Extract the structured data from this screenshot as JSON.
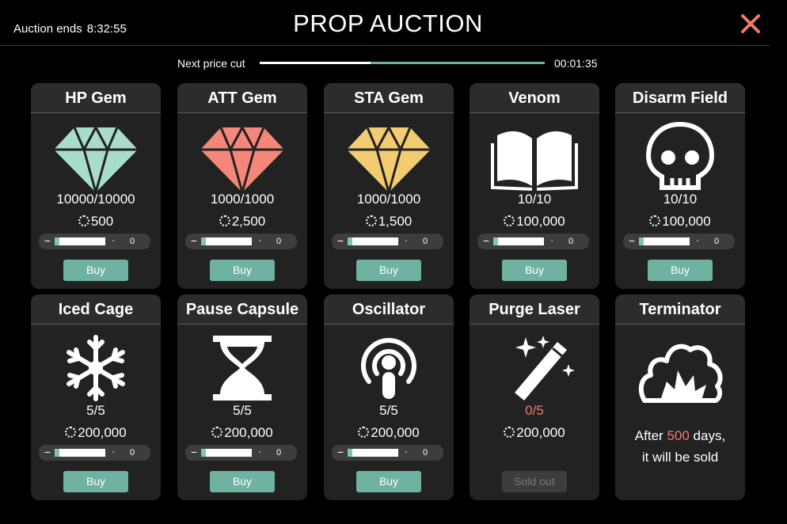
{
  "header": {
    "ends_label": "Auction ends",
    "ends_time": "8:32:55",
    "title": "PROP AUCTION",
    "close_icon": "close-icon",
    "accent": "#f07b6c"
  },
  "price_cut": {
    "label": "Next price cut",
    "time": "00:01:35",
    "progress_percent": 39
  },
  "colors": {
    "button": "#6fb2a2",
    "hp_gem": "#a8dccb",
    "att_gem": "#f5867a",
    "sta_gem": "#f3cb70",
    "sold_out_stock": "#f07b6c"
  },
  "items": [
    {
      "name": "HP Gem",
      "icon": "diamond-icon",
      "stock": "10000/10000",
      "price": "500",
      "qty": "0",
      "buy": "Buy"
    },
    {
      "name": "ATT Gem",
      "icon": "diamond-icon",
      "stock": "1000/1000",
      "price": "2,500",
      "qty": "0",
      "buy": "Buy"
    },
    {
      "name": "STA Gem",
      "icon": "diamond-icon",
      "stock": "1000/1000",
      "price": "1,500",
      "qty": "0",
      "buy": "Buy"
    },
    {
      "name": "Venom",
      "icon": "book-icon",
      "stock": "10/10",
      "price": "100,000",
      "qty": "0",
      "buy": "Buy"
    },
    {
      "name": "Disarm Field",
      "icon": "skull-icon",
      "stock": "10/10",
      "price": "100,000",
      "qty": "0",
      "buy": "Buy"
    },
    {
      "name": "Iced Cage",
      "icon": "snowflake-icon",
      "stock": "5/5",
      "price": "200,000",
      "qty": "0",
      "buy": "Buy"
    },
    {
      "name": "Pause Capsule",
      "icon": "hourglass-icon",
      "stock": "5/5",
      "price": "200,000",
      "qty": "0",
      "buy": "Buy"
    },
    {
      "name": "Oscillator",
      "icon": "broadcast-icon",
      "stock": "5/5",
      "price": "200,000",
      "qty": "0",
      "buy": "Buy"
    },
    {
      "name": "Purge Laser",
      "icon": "magic-wand-icon",
      "stock": "0/5",
      "price": "200,000",
      "buy": "Sold out"
    },
    {
      "name": "Terminator",
      "icon": "explosion-icon",
      "after_prefix": "After",
      "after_days": "500",
      "after_suffix": "days,",
      "after_line2": "it will be sold"
    }
  ],
  "controls": {
    "minus": "−",
    "plus": "+"
  }
}
